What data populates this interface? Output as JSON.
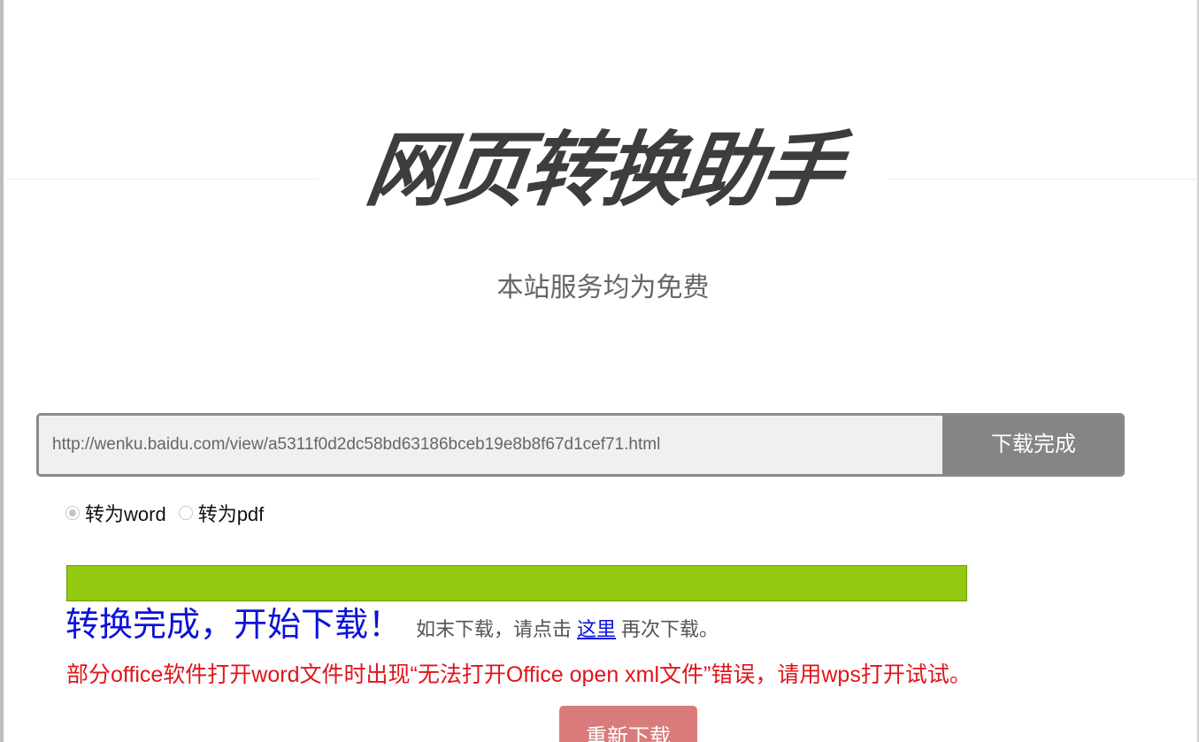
{
  "header": {
    "logo_text": "网页转换助手",
    "subtitle": "本站服务均为免费"
  },
  "search": {
    "url_value": "http://wenku.baidu.com/view/a5311f0d2dc58bd63186bceb19e8b8f67d1cef71.html",
    "button_label": "下载完成"
  },
  "format_options": {
    "selected": "word",
    "options": [
      {
        "id": "word",
        "label": "转为word",
        "checked": true
      },
      {
        "id": "pdf",
        "label": "转为pdf",
        "checked": false
      }
    ]
  },
  "progress": {
    "percent": 100,
    "fill_color": "#93c90e",
    "border_color": "#6e9a12"
  },
  "status": {
    "done_text": "转换完成，开始下载！",
    "hint_before": "如末下载，请点击",
    "link_text": "这里",
    "hint_after": "再次下载。"
  },
  "warning": {
    "text": "部分office软件打开word文件时出现“无法打开Office open xml文件”错误，请用wps打开试试。",
    "color": "#e0151b"
  },
  "actions": {
    "retry_label": "重新下载"
  },
  "colors": {
    "accent_blue": "#0b11d9",
    "button_gray": "#858585",
    "retry_red": "#d97b7b"
  }
}
